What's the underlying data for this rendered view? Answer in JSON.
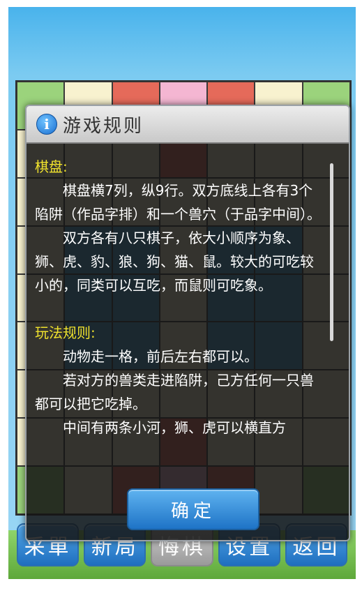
{
  "dialog": {
    "title": "游戏规则",
    "icon": "info-icon",
    "sections": {
      "board": {
        "heading": "棋盘:",
        "p1": "棋盘横7列，纵9行。双方底线上各有3个陷阱（作品字排）和一个兽穴（于品字中间）。",
        "p2": "双方各有八只棋子，依大小顺序为象、狮、虎、豹、狼、狗、猫、鼠。较大的可吃较小的，同类可以互吃，而鼠则可吃象。"
      },
      "rules": {
        "heading": "玩法规则:",
        "p1": "动物走一格，前后左右都可以。",
        "p2": "若对方的兽类走进陷阱，己方任何一只兽都可以把它吃掉。",
        "p3": "中间有两条小河，狮、虎可以横直方"
      }
    },
    "confirm_label": "确定"
  },
  "toolbar": {
    "items": [
      "采單",
      "新局",
      "悔棋",
      "设置",
      "返回"
    ]
  },
  "colors": {
    "accent": "#1f6fbf",
    "section_heading": "#f0e22d",
    "dialog_bg": "#141414"
  }
}
